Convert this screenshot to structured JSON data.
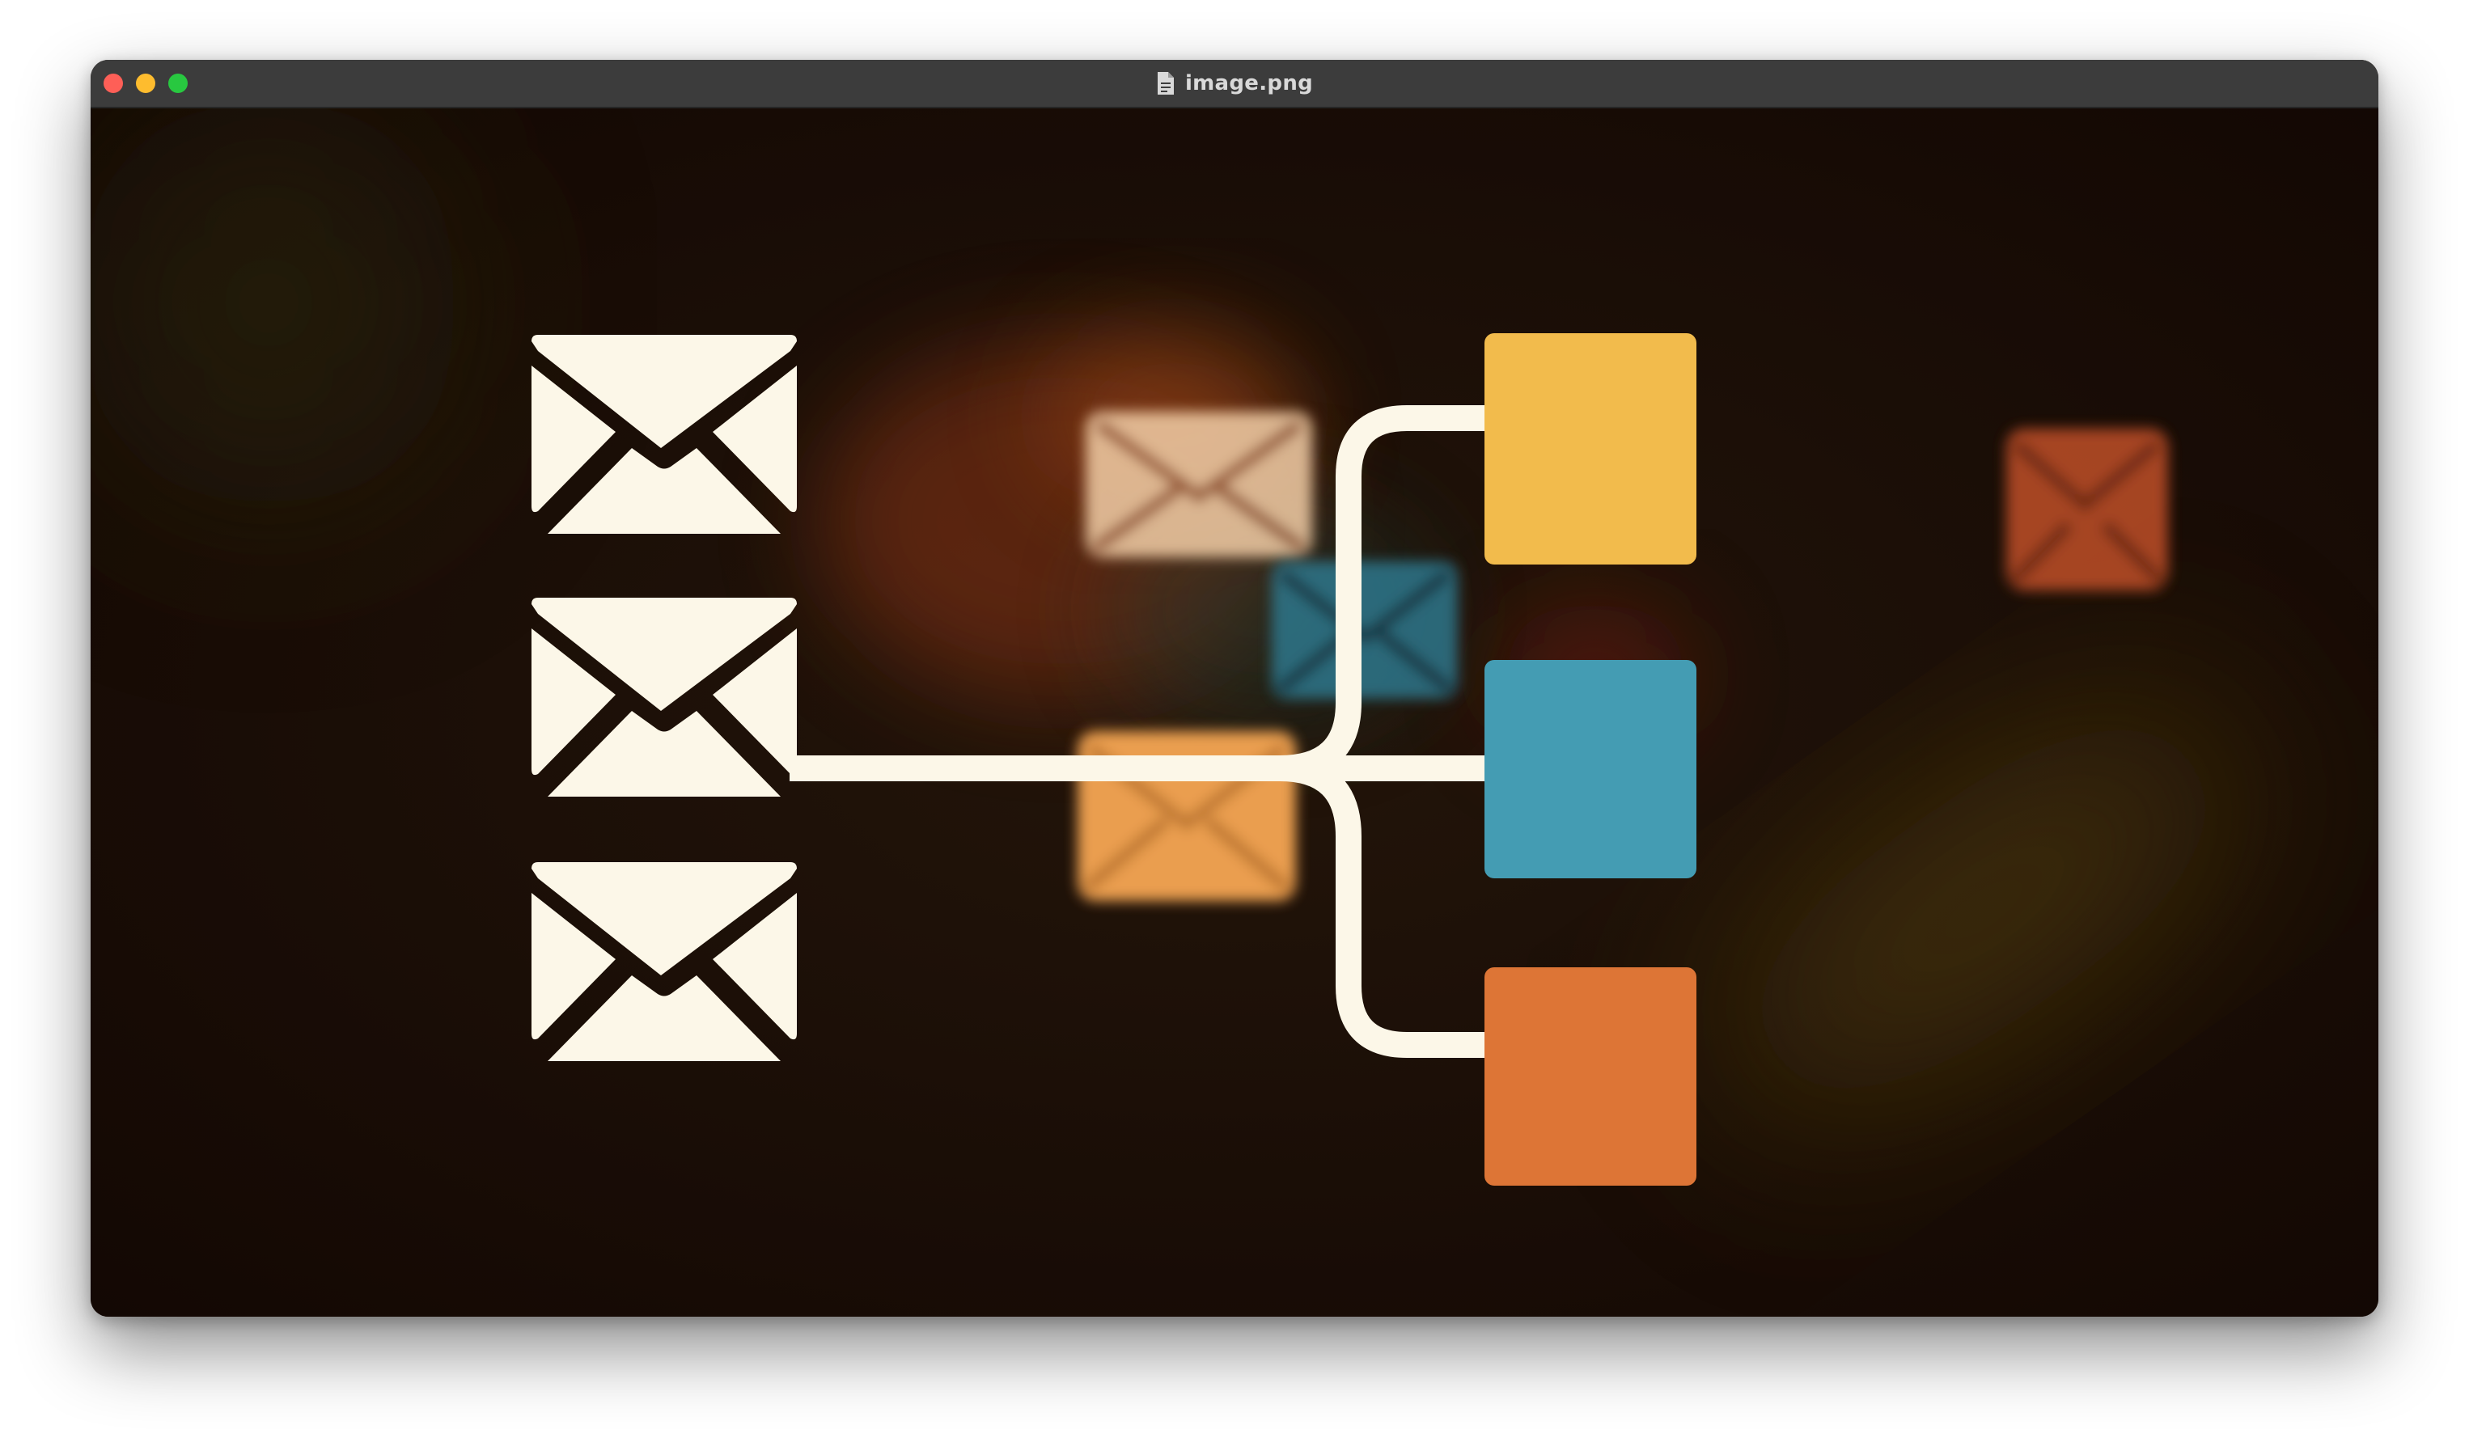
{
  "window": {
    "title": "image.png",
    "title_icon": "document-icon"
  },
  "colors": {
    "envelope": "#fcf7e8",
    "box_yellow": "#f2bb4c",
    "box_blue": "#449cb3",
    "box_orange": "#dd7536",
    "background": "#1b0d05"
  },
  "icons": {
    "envelopes": [
      "envelope-icon",
      "envelope-icon",
      "envelope-icon"
    ],
    "blurred_background": [
      "envelope-icon",
      "envelope-icon",
      "envelope-icon",
      "envelope-icon"
    ]
  }
}
